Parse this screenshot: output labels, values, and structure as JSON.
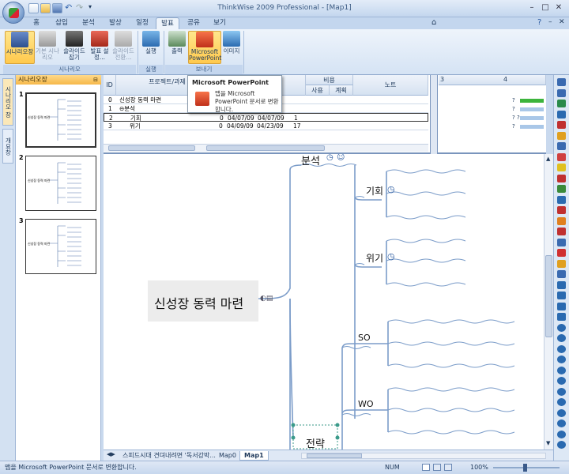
{
  "window": {
    "title": "ThinkWise 2009 Professional - [Map1]"
  },
  "tabs": [
    "홈",
    "삽입",
    "분석",
    "발상",
    "일정",
    "발표",
    "공유",
    "보기"
  ],
  "ribbon": {
    "buttons": [
      "시나리오장",
      "기본 시나리오",
      "슬라이드 잡기",
      "발표 설정...",
      "슬라이드 전환...",
      "실행",
      "출력",
      "Microsoft PowerPoint",
      "이미지"
    ],
    "groups": [
      "시나리오",
      "실행",
      "보내기"
    ]
  },
  "left_tabs": [
    "시나리오 장",
    "개요창"
  ],
  "scenario": {
    "title": "시나리오장",
    "slides": [
      {
        "num": "1",
        "caption": "신성장 동력 마련"
      },
      {
        "num": "2",
        "caption": "신성장 동력 마련"
      },
      {
        "num": "3",
        "caption": "신성장 동력 마련"
      }
    ]
  },
  "grid": {
    "headers": {
      "id": "ID",
      "task": "프로젝트/과제",
      "cost": "비용",
      "use": "사용",
      "plan": "계획",
      "note": "노트"
    },
    "gantt_numbers": [
      "3",
      "4"
    ],
    "rows": [
      {
        "id": "0",
        "task": "신성장 동력 마련",
        "a": "",
        "start": "",
        "end": "",
        "val": ""
      },
      {
        "id": "1",
        "task": "⊖분석",
        "a": "",
        "start": "",
        "end": "",
        "val": ""
      },
      {
        "id": "2",
        "task": "기회",
        "a": "0",
        "start": "04/07/09",
        "end": "04/07/09",
        "val": "1"
      },
      {
        "id": "3",
        "task": "위기",
        "a": "0",
        "start": "04/09/09",
        "end": "04/23/09",
        "val": "17"
      }
    ],
    "gantt_marks": [
      "?",
      "?",
      "? ?",
      "?"
    ]
  },
  "popup": {
    "title": "Microsoft PowerPoint",
    "desc": "맵을 Microsoft PowerPoint 문서로 변환합니다."
  },
  "map": {
    "root": "신성장 동력 마련",
    "nodes": [
      "분석",
      "기회",
      "위기",
      "SO",
      "WO",
      "전략"
    ]
  },
  "sheets": [
    "스피드시대 견뎌내려면 '독서강박...",
    "Map0",
    "Map1"
  ],
  "status": {
    "text": "맵을 Microsoft PowerPoint 문서로 변환합니다.",
    "num": "NUM",
    "zoom": "100%"
  }
}
